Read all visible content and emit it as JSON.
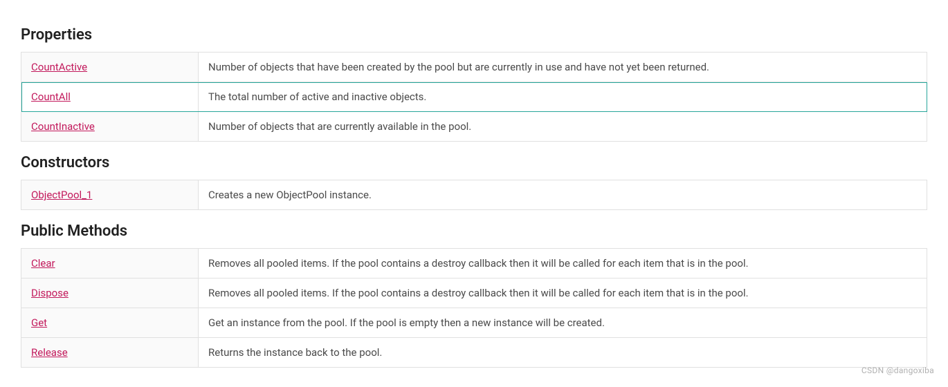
{
  "sections": [
    {
      "heading": "Properties",
      "rows": [
        {
          "name": "CountActive",
          "desc": "Number of objects that have been created by the pool but are currently in use and have not yet been returned.",
          "highlighted": false
        },
        {
          "name": "CountAll",
          "desc": "The total number of active and inactive objects.",
          "highlighted": true
        },
        {
          "name": "CountInactive",
          "desc": "Number of objects that are currently available in the pool.",
          "highlighted": false
        }
      ]
    },
    {
      "heading": "Constructors",
      "rows": [
        {
          "name": "ObjectPool_1",
          "desc": "Creates a new ObjectPool instance.",
          "highlighted": false
        }
      ]
    },
    {
      "heading": "Public Methods",
      "rows": [
        {
          "name": "Clear",
          "desc": "Removes all pooled items. If the pool contains a destroy callback then it will be called for each item that is in the pool.",
          "highlighted": false
        },
        {
          "name": "Dispose",
          "desc": "Removes all pooled items. If the pool contains a destroy callback then it will be called for each item that is in the pool.",
          "highlighted": false
        },
        {
          "name": "Get",
          "desc": "Get an instance from the pool. If the pool is empty then a new instance will be created.",
          "highlighted": false
        },
        {
          "name": "Release",
          "desc": "Returns the instance back to the pool.",
          "highlighted": false
        }
      ]
    }
  ],
  "watermark": "CSDN @dangoxiba"
}
